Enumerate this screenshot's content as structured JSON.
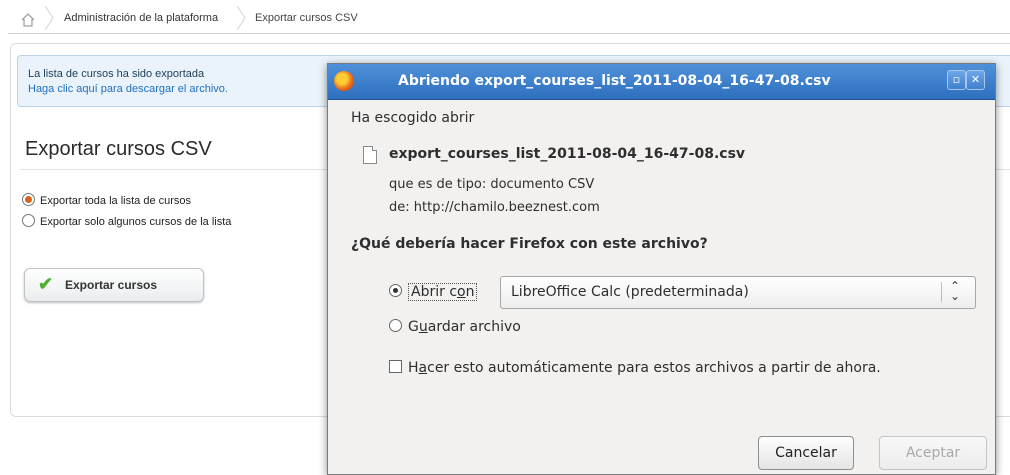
{
  "breadcrumb": {
    "items": [
      "Administración de la plataforma",
      "Exportar cursos CSV"
    ]
  },
  "notice": {
    "message": "La lista de cursos ha sido exportada",
    "link": "Haga clic aquí para descargar el archivo."
  },
  "page": {
    "title": "Exportar cursos CSV",
    "options": [
      {
        "label": "Exportar toda la lista de cursos",
        "selected": true
      },
      {
        "label": "Exportar solo algunos cursos de la lista",
        "selected": false
      }
    ],
    "export_button": "Exportar cursos"
  },
  "dialog": {
    "title": "Abriendo export_courses_list_2011-08-04_16-47-08.csv",
    "chosen_label": "Ha escogido abrir",
    "file_name": "export_courses_list_2011-08-04_16-47-08.csv",
    "file_type": "que es de tipo:  documento CSV",
    "file_from": "de:  http://chamilo.beeznest.com",
    "question": "¿Qué debería hacer Firefox con este archivo?",
    "open_with_pre": "Abrir c",
    "open_with_key": "o",
    "open_with_post": "n",
    "open_with_selected": true,
    "app_selected": "LibreOffice Calc (predeterminada)",
    "save_pre": "G",
    "save_key": "u",
    "save_post": "ardar archivo",
    "auto_pre": "H",
    "auto_key": "a",
    "auto_post": "cer esto automáticamente para estos archivos a partir de ahora.",
    "auto_checked": false,
    "cancel": "Cancelar",
    "accept": "Aceptar"
  },
  "colors": {
    "titlebar": "#3a7fcf",
    "dialog_bg": "#f2f1f0",
    "notice_bg": "#eaf3fb",
    "link": "#1f6fbf"
  }
}
